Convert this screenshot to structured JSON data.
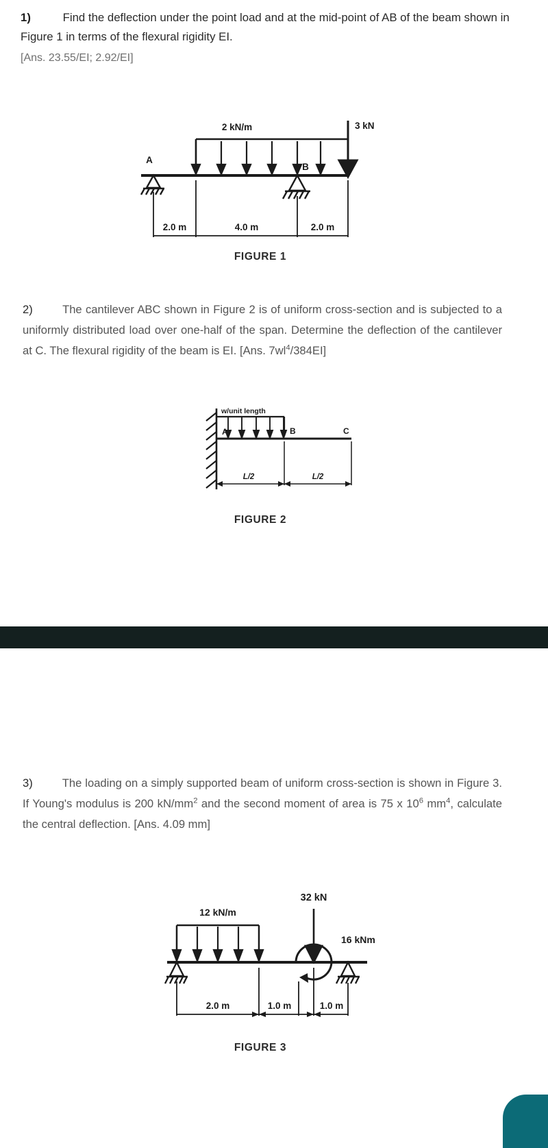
{
  "questions": [
    {
      "number": "1)",
      "text": "Find the deflection under the point load and at the mid-point of AB of the beam shown in Figure 1 in terms of the flexural rigidity EI.",
      "answer": "[Ans. 23.55/EI; 2.92/EI]"
    },
    {
      "number": "2)",
      "text": "The cantilever ABC shown in Figure 2 is of uniform cross-section and is subjected to a uniformly distributed load over one-half of the span. Determine the deflection of the cantilever at C. The flexural rigidity of the beam is EI.",
      "answer_prefix": "[Ans. 7wl",
      "answer_sup": "4",
      "answer_suffix": "/384EI]"
    },
    {
      "number": "3)",
      "text_part1": "The loading on a simply supported beam of uniform cross-section is shown in Figure 3. If Young's modulus is 200 kN/mm",
      "sup1": "2",
      "text_part2": " and the second moment of area is 75 x 10",
      "sup2": "6",
      "text_part3": " mm",
      "sup3": "4",
      "text_part4": ", calculate the central deflection. [Ans. 4.09 mm]"
    }
  ],
  "figure1": {
    "caption": "FIGURE 1",
    "udl_label": "2 kN/m",
    "point_load_label": "3 kN",
    "support_a_label": "A",
    "support_b_label": "B",
    "dim1": "2.0 m",
    "dim2": "4.0 m",
    "dim3": "2.0 m"
  },
  "figure2": {
    "caption": "FIGURE 2",
    "udl_label": "w/unit length",
    "point_a_label": "A",
    "point_b_label": "B",
    "point_c_label": "C",
    "dim1": "L/2",
    "dim2": "L/2"
  },
  "figure3": {
    "caption": "FIGURE 3",
    "udl_label": "12 kN/m",
    "point_load_label": "32 kN",
    "moment_label": "16 kNm",
    "dim1": "2.0 m",
    "dim2": "1.0 m",
    "dim3": "1.0 m"
  },
  "colors": {
    "ink": "#2b2b2b",
    "body_text": "#555555",
    "answer_gray": "#6f6f6f",
    "band": "#14201f",
    "corner_accent": "#0c6b77"
  }
}
